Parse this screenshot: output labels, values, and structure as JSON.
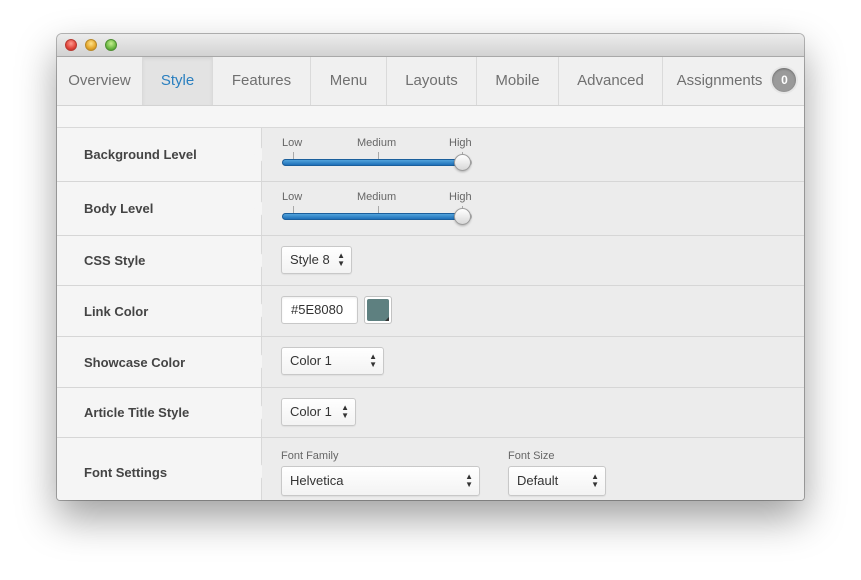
{
  "window": {
    "tabs": [
      {
        "label": "Overview"
      },
      {
        "label": "Style"
      },
      {
        "label": "Features"
      },
      {
        "label": "Menu"
      },
      {
        "label": "Layouts"
      },
      {
        "label": "Mobile"
      },
      {
        "label": "Advanced"
      },
      {
        "label": "Assignments",
        "badge": "0"
      }
    ],
    "active_tab": "Style",
    "accent_color": "#2a7fbf"
  },
  "settings": {
    "background_level": {
      "label": "Background Level",
      "ticks": [
        "Low",
        "Medium",
        "High"
      ],
      "value": "High"
    },
    "body_level": {
      "label": "Body Level",
      "ticks": [
        "Low",
        "Medium",
        "High"
      ],
      "value": "High"
    },
    "css_style": {
      "label": "CSS Style",
      "value": "Style 8"
    },
    "link_color": {
      "label": "Link Color",
      "value": "#5E8080",
      "swatch": "#5e8080"
    },
    "showcase_color": {
      "label": "Showcase Color",
      "value": "Color 1"
    },
    "article_title_style": {
      "label": "Article Title Style",
      "value": "Color 1"
    },
    "font_settings": {
      "label": "Font Settings",
      "family_caption": "Font Family",
      "family_value": "Helvetica",
      "size_caption": "Font Size",
      "size_value": "Default"
    }
  }
}
